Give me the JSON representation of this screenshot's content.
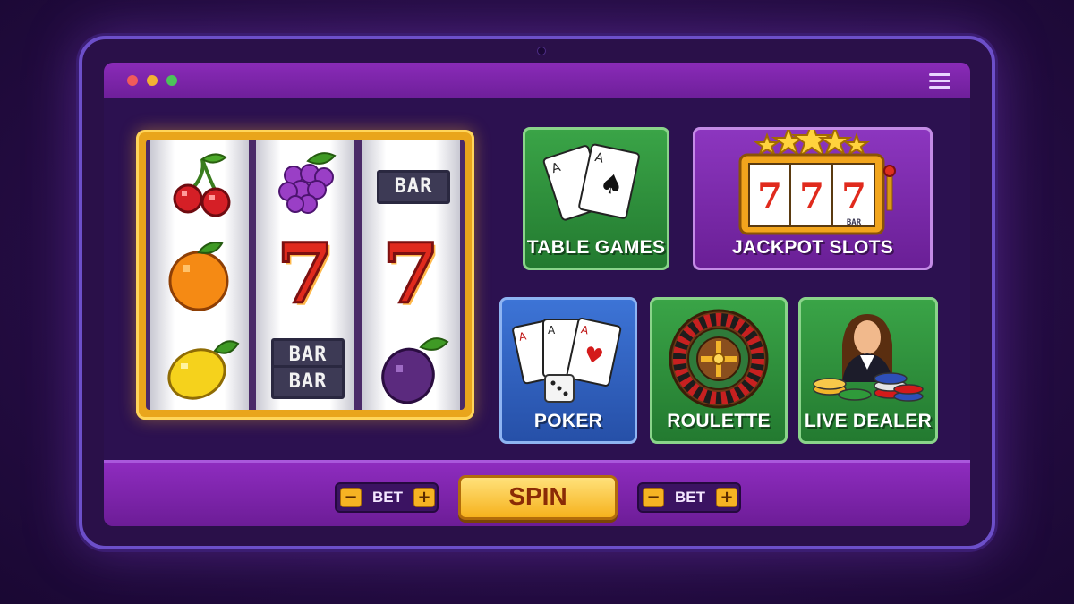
{
  "window": {
    "controls": [
      {
        "name": "close",
        "color": "#f05b5b"
      },
      {
        "name": "minimize",
        "color": "#f2b233"
      },
      {
        "name": "maximize",
        "color": "#4cc35a"
      }
    ],
    "menu_icon": "hamburger-menu-icon"
  },
  "slot_machine": {
    "reels": [
      [
        "cherries",
        "orange",
        "lemon"
      ],
      [
        "grapes",
        "seven",
        "double-bar"
      ],
      [
        "bar",
        "seven",
        "plum"
      ]
    ],
    "bar_text": "BAR",
    "seven_text": "7"
  },
  "games": {
    "table_games": {
      "label": "TABLE GAMES",
      "icon": "playing-cards-icon",
      "color": "#2e8f3a"
    },
    "jackpot_slots": {
      "label": "JACKPOT SLOTS",
      "icon": "slot-machine-icon",
      "color": "#7a2aa8",
      "seven_text": "7",
      "bar_text": "BAR"
    },
    "poker": {
      "label": "POKER",
      "icon": "cards-and-dice-icon",
      "color": "#2f5fc4"
    },
    "roulette": {
      "label": "ROULETTE",
      "icon": "roulette-wheel-icon",
      "color": "#2e8f3a"
    },
    "live_dealer": {
      "label": "LIVE DEALER",
      "icon": "dealer-with-chips-icon",
      "color": "#2e8f3a"
    }
  },
  "controls": {
    "left_bet": {
      "minus": "−",
      "label": "BET",
      "plus": "+"
    },
    "spin_label": "SPIN",
    "right_bet": {
      "minus": "−",
      "label": "BET",
      "plus": "+"
    }
  }
}
